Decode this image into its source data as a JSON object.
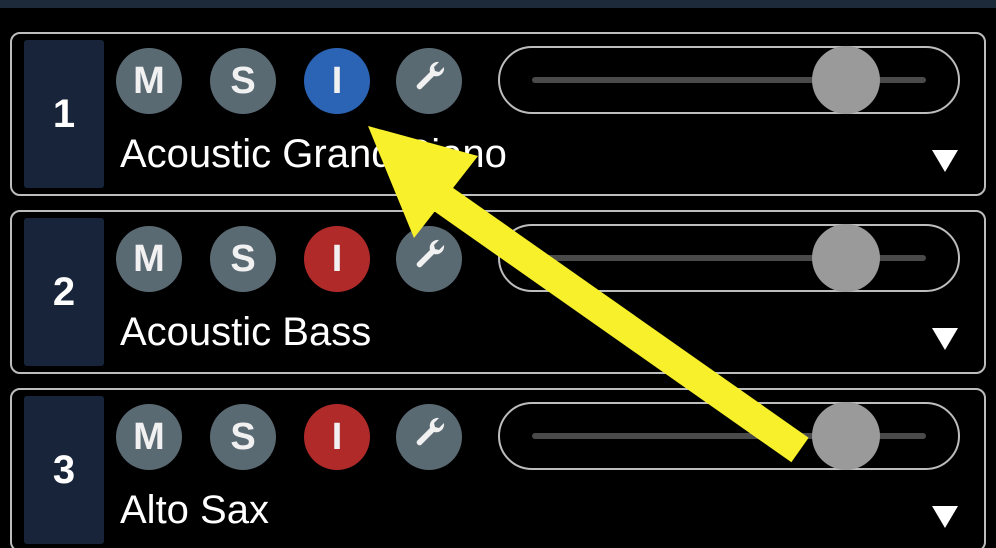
{
  "tracks": [
    {
      "number": "1",
      "mute_label": "M",
      "solo_label": "S",
      "input_label": "I",
      "input_state": "blue",
      "settings_icon": "wrench-icon",
      "volume_level": 0.8,
      "instrument": "Acoustic Grand Piano"
    },
    {
      "number": "2",
      "mute_label": "M",
      "solo_label": "S",
      "input_label": "I",
      "input_state": "red",
      "settings_icon": "wrench-icon",
      "volume_level": 0.8,
      "instrument": "Acoustic Bass"
    },
    {
      "number": "3",
      "mute_label": "M",
      "solo_label": "S",
      "input_label": "I",
      "input_state": "red",
      "settings_icon": "wrench-icon",
      "volume_level": 0.8,
      "instrument": "Alto Sax"
    }
  ],
  "colors": {
    "button_gray": "#5a6a73",
    "input_blue": "#2b63b5",
    "input_red": "#b02a2a",
    "annotation_arrow": "#f7f02a"
  },
  "annotation": {
    "icon": "arrow-annotation-icon"
  }
}
